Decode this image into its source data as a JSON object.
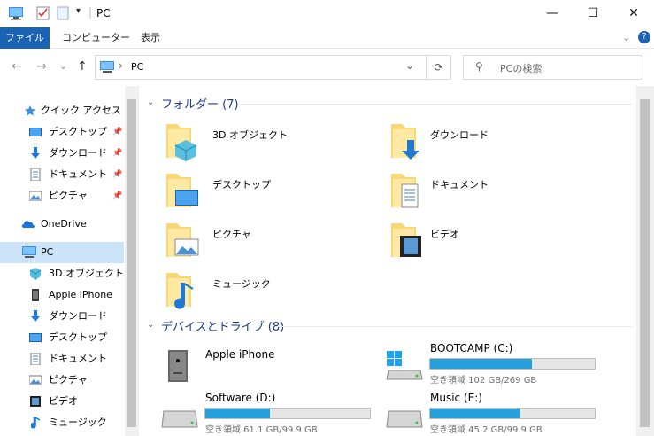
{
  "window": {
    "title": "PC",
    "minimize": "—",
    "maximize": "☐",
    "close": "✕"
  },
  "ribbon": {
    "tabs": [
      "ファイル",
      "コンピューター",
      "表示"
    ],
    "help": "?"
  },
  "nav": {
    "back": "←",
    "forward": "→",
    "recent": "⌄",
    "up": "↑"
  },
  "address": {
    "path_sep": "›",
    "path": "PC",
    "dropdown": "⌄",
    "refresh": "⟳"
  },
  "search": {
    "placeholder": "PCの検索"
  },
  "sidebar": {
    "quick_access": "クイック アクセス",
    "qa_items": [
      "デスクトップ",
      "ダウンロード",
      "ドキュメント",
      "ピクチャ"
    ],
    "onedrive": "OneDrive",
    "pc": "PC",
    "pc_items": [
      "3D オブジェクト",
      "Apple iPhone",
      "ダウンロード",
      "デスクトップ",
      "ドキュメント",
      "ピクチャ",
      "ビデオ",
      "ミュージック"
    ],
    "pin": "📌"
  },
  "folders": {
    "header": "フォルダー (7)",
    "items": [
      "3D オブジェクト",
      "ダウンロード",
      "デスクトップ",
      "ドキュメント",
      "ピクチャ",
      "ビデオ",
      "ミュージック"
    ]
  },
  "drives": {
    "header": "デバイスとドライブ (8)",
    "items": [
      {
        "name": "Apple iPhone"
      },
      {
        "name": "BOOTCAMP (C:)",
        "free": "空き領域 102 GB/269 GB",
        "used_fraction": 0.62
      },
      {
        "name": "Software (D:)",
        "free": "空き領域 61.1 GB/99.9 GB",
        "used_fraction": 0.39
      },
      {
        "name": "Music (E:)",
        "free": "空き領域 45.2 GB/99.9 GB",
        "used_fraction": 0.55
      }
    ]
  }
}
